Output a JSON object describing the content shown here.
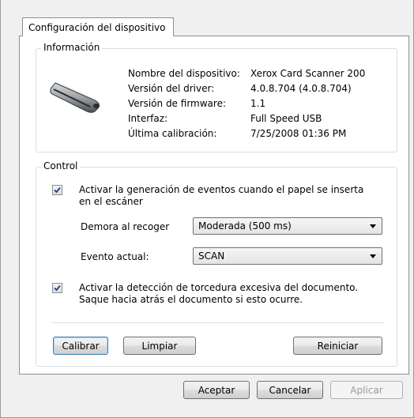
{
  "tab": {
    "label": "Configuración del dispositivo"
  },
  "info": {
    "legend": "Información",
    "rows": [
      {
        "label": "Nombre del dispositivo:",
        "value": "Xerox Card Scanner 200"
      },
      {
        "label": "Versión del driver:",
        "value": "4.0.8.704 (4.0.8.704)"
      },
      {
        "label": "Versión de firmware:",
        "value": "1.1"
      },
      {
        "label": "Interfaz:",
        "value": "Full Speed USB"
      },
      {
        "label": "Última calibración:",
        "value": "7/25/2008  01:36 PM"
      }
    ],
    "device_icon": "scanner-icon"
  },
  "control": {
    "legend": "Control",
    "event_checkbox": {
      "checked": true,
      "line1": "Activar la generación de eventos cuando el papel se inserta",
      "line2": "en el escáner"
    },
    "pickup_delay": {
      "label": "Demora al recoger",
      "value": "Moderada (500 ms)"
    },
    "current_event": {
      "label": "Evento actual:",
      "value": "SCAN"
    },
    "skew_checkbox": {
      "checked": true,
      "line1": "Activar la detección de torcedura excesiva del documento.",
      "line2": "Saque hacia atrás el documento si esto ocurre."
    },
    "buttons": {
      "calibrate": "Calibrar",
      "clean": "Limpiar",
      "reset": "Reiniciar"
    }
  },
  "footer": {
    "ok": "Aceptar",
    "cancel": "Cancelar",
    "apply": "Aplicar"
  },
  "colors": {
    "accent": "#3c7fb1",
    "groupbox_border": "#d5dfe5",
    "check": "#1e3f92"
  }
}
